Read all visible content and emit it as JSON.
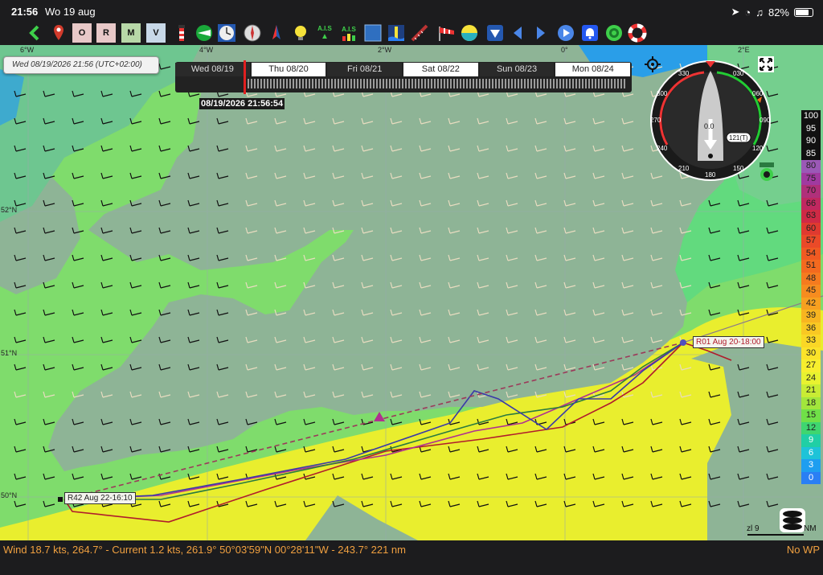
{
  "status_bar": {
    "time": "21:56",
    "date": "Wo 19 aug",
    "battery": "82%"
  },
  "toolbar": {
    "items": [
      {
        "icon": "back-chevron-icon",
        "label": ""
      },
      {
        "icon": "map-pin-icon",
        "label": ""
      },
      {
        "icon": "chart-o-icon",
        "label": "O"
      },
      {
        "icon": "chart-r-icon",
        "label": "R"
      },
      {
        "icon": "chart-m-icon",
        "label": "M"
      },
      {
        "icon": "chart-v-icon",
        "label": "V"
      },
      {
        "icon": "lighthouse-icon",
        "label": ""
      },
      {
        "icon": "sailing-icon",
        "label": ""
      },
      {
        "icon": "clock-compass-icon",
        "label": ""
      },
      {
        "icon": "compass-icon",
        "label": ""
      },
      {
        "icon": "north-arrow-icon",
        "label": ""
      },
      {
        "icon": "lightbulb-icon",
        "label": ""
      },
      {
        "icon": "ais-icon",
        "label": "A.I.S"
      },
      {
        "icon": "ais-bars-icon",
        "label": "A.I.S"
      },
      {
        "icon": "layer-icon",
        "label": ""
      },
      {
        "icon": "tide-station-icon",
        "label": ""
      },
      {
        "icon": "ruler-icon",
        "label": ""
      },
      {
        "icon": "windsock-icon",
        "label": ""
      },
      {
        "icon": "grib-weather-icon",
        "label": ""
      },
      {
        "icon": "waypoint-list-icon",
        "label": ""
      },
      {
        "icon": "arrow-left-icon",
        "label": ""
      },
      {
        "icon": "arrow-right-icon",
        "label": ""
      },
      {
        "icon": "play-icon",
        "label": ""
      },
      {
        "icon": "alarm-bell-icon",
        "label": ""
      },
      {
        "icon": "target-green-icon",
        "label": ""
      },
      {
        "icon": "lifebuoy-icon",
        "label": ""
      }
    ]
  },
  "date_label": "Wed 08/19/2026 21:56 (UTC+02:00)",
  "timeline": {
    "days": [
      "Wed 08/19",
      "Thu 08/20",
      "Fri 08/21",
      "Sat 08/22",
      "Sun 08/23",
      "Mon 08/24"
    ],
    "current_time": "08/19/2026 21:56:54"
  },
  "grid": {
    "lon_labels": [
      "6°W",
      "4°W",
      "2°W",
      "0°",
      "2°E"
    ],
    "lat_labels": [
      "52°N",
      "51°N",
      "50°N"
    ]
  },
  "compass": {
    "headings": [
      "330",
      "030",
      "300",
      "060",
      "270",
      "090",
      "240",
      "120",
      "210",
      "150",
      "180"
    ],
    "speed": "0.0",
    "bearing": "121(T)"
  },
  "legend": {
    "values": [
      "100",
      "95",
      "90",
      "85",
      "80",
      "75",
      "70",
      "66",
      "63",
      "60",
      "57",
      "54",
      "51",
      "48",
      "45",
      "42",
      "39",
      "36",
      "33",
      "30",
      "27",
      "24",
      "21",
      "18",
      "15",
      "12",
      "9",
      "6",
      "3",
      "0"
    ],
    "colors": [
      "#ffffff",
      "#e6e6e6",
      "#cccccc",
      "#b3b3b3",
      "#9b59b6",
      "#a03aa0",
      "#b0307a",
      "#c02860",
      "#cf2a45",
      "#df3a30",
      "#ea4a28",
      "#f05a22",
      "#f36a1f",
      "#f57b1f",
      "#f68c1f",
      "#f7a020",
      "#f8b520",
      "#f9c823",
      "#fad726",
      "#fbe32a",
      "#f7ee2e",
      "#e8f230",
      "#c8ec34",
      "#a2e63c",
      "#70e048",
      "#3fd670",
      "#20cfa5",
      "#1ec3d8",
      "#1e9ef0",
      "#2a7ff4"
    ]
  },
  "routes": {
    "start_label": "R01 Aug 20-18:00",
    "end_label": "R42 Aug 22-16:10"
  },
  "scale": {
    "zoom": "zl 9",
    "unit": "NM"
  },
  "bottom_bar": {
    "info": "Wind 18.7 kts, 264.7° - Current 1.2 kts, 261.9° 50°03'59\"N 00°28'11\"W - 243.7° 221 nm",
    "waypoint": "No WP"
  }
}
